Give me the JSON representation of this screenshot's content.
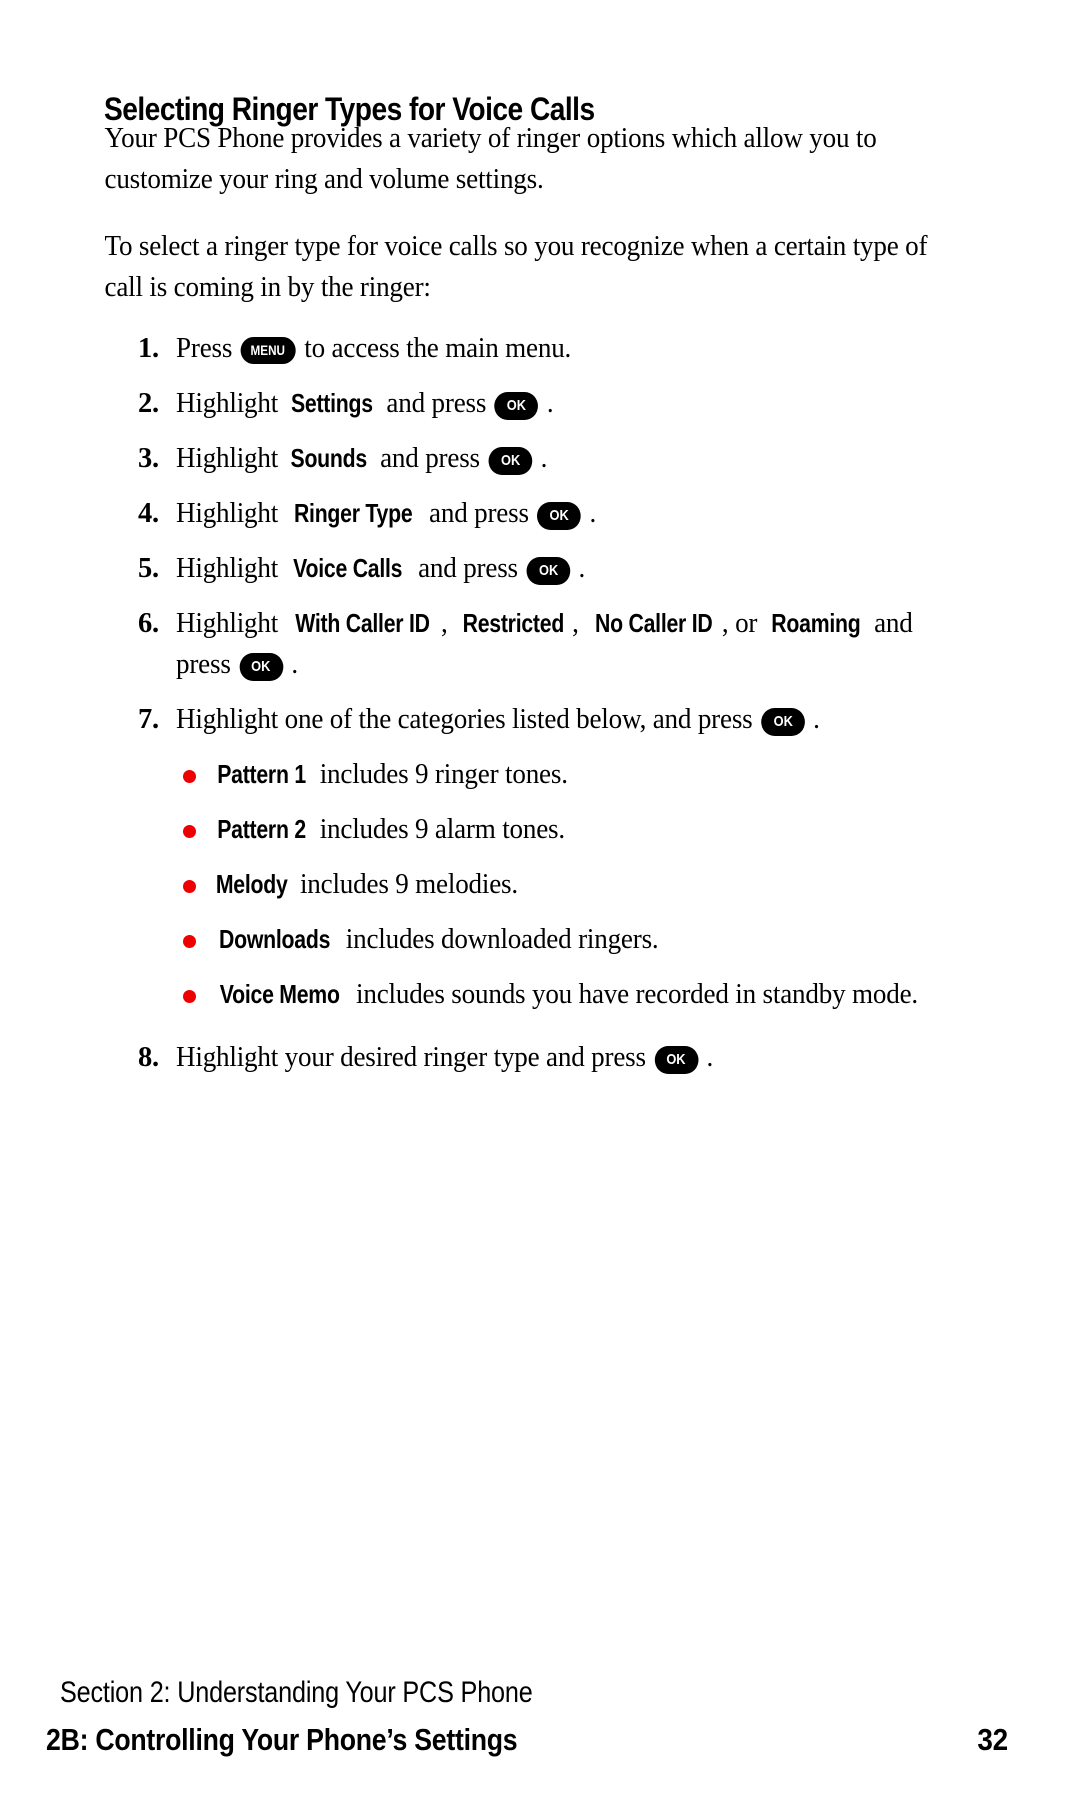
{
  "heading": "Selecting Ringer Types for Voice Calls",
  "paragraphs": [
    "Your PCS Phone provides a variety of ringer options which allow you to customize your ring and volume settings.",
    "To select a ringer type for voice calls so you recognize when a certain type of call is coming in by the ringer:"
  ],
  "keys": {
    "menu": "MENU",
    "ok": "OK"
  },
  "steps": [
    {
      "number": "1.",
      "pre": "Press ",
      "key": "menu",
      "post": " to access the main menu."
    },
    {
      "number": "2.",
      "pre": "Highlight ",
      "bold": "Settings",
      "mid": " and press ",
      "key": "ok",
      "post": " ."
    },
    {
      "number": "3.",
      "pre": "Highlight ",
      "bold": "Sounds",
      "mid": " and press ",
      "key": "ok",
      "post": " ."
    },
    {
      "number": "4.",
      "pre": "Highlight ",
      "bold": "Ringer Type",
      "mid": " and press ",
      "key": "ok",
      "post": " ."
    },
    {
      "number": "5.",
      "pre": "Highlight ",
      "bold": "Voice Calls",
      "mid": " and press ",
      "key": "ok",
      "post": " ."
    },
    {
      "number": "6.",
      "pre": "Highlight ",
      "bold_list": [
        "With Caller ID",
        "Restricted",
        "No Caller ID",
        "Roaming"
      ],
      "separators": [
        ", ",
        ", ",
        ", or "
      ],
      "mid": " and press ",
      "key": "ok",
      "post": " ."
    },
    {
      "number": "7.",
      "pre": "Highlight one of the categories listed below, and press ",
      "key": "ok",
      "post": " ."
    },
    {
      "number": "8.",
      "pre": "Highlight your desired ringer type and press ",
      "key": "ok",
      "post": " ."
    }
  ],
  "bullets": [
    {
      "term": "Pattern 1",
      "desc": " includes 9 ringer tones."
    },
    {
      "term": "Pattern 2",
      "desc": " includes 9 alarm tones."
    },
    {
      "term": "Melody",
      "desc": " includes 9 melodies."
    },
    {
      "term": "Downloads",
      "desc": " includes downloaded ringers."
    },
    {
      "term": "Voice Memo",
      "desc": " includes sounds you have recorded in standby mode."
    }
  ],
  "bullet_color": "#ee0000",
  "footer": {
    "section": "Section 2: Understanding Your PCS Phone",
    "chapter": "2B: Controlling Your Phone’s Settings",
    "page_number": "32"
  }
}
